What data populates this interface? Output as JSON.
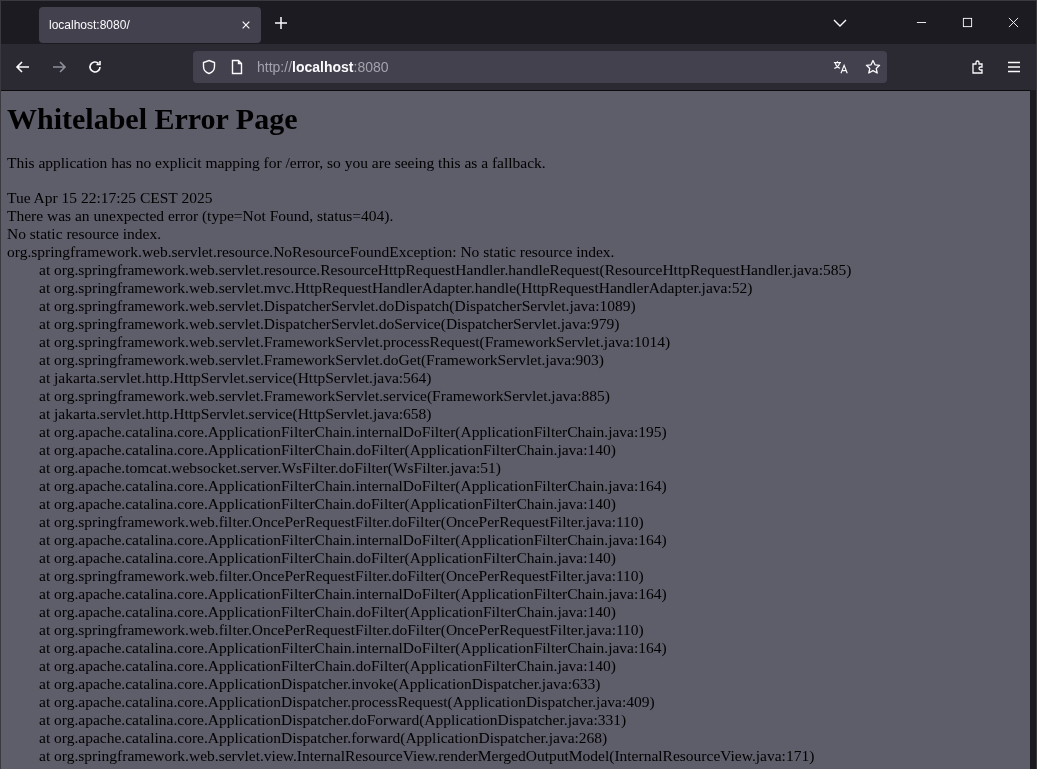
{
  "tabs": [
    {
      "title": "localhost:8080/",
      "selected": true
    }
  ],
  "url": {
    "scheme": "http://",
    "host": "localhost",
    "port": ":8080"
  },
  "nav": {
    "forward_disabled": true
  },
  "page": {
    "heading": "Whitelabel Error Page",
    "intro": "This application has no explicit mapping for /error, so you are seeing this as a fallback.",
    "lines": [
      "Tue Apr 15 22:17:25 CEST 2025",
      "There was an unexpected error (type=Not Found, status=404).",
      "No static resource index.",
      "org.springframework.web.servlet.resource.NoResourceFoundException: No static resource index."
    ],
    "trace": [
      "at org.springframework.web.servlet.resource.ResourceHttpRequestHandler.handleRequest(ResourceHttpRequestHandler.java:585)",
      "at org.springframework.web.servlet.mvc.HttpRequestHandlerAdapter.handle(HttpRequestHandlerAdapter.java:52)",
      "at org.springframework.web.servlet.DispatcherServlet.doDispatch(DispatcherServlet.java:1089)",
      "at org.springframework.web.servlet.DispatcherServlet.doService(DispatcherServlet.java:979)",
      "at org.springframework.web.servlet.FrameworkServlet.processRequest(FrameworkServlet.java:1014)",
      "at org.springframework.web.servlet.FrameworkServlet.doGet(FrameworkServlet.java:903)",
      "at jakarta.servlet.http.HttpServlet.service(HttpServlet.java:564)",
      "at org.springframework.web.servlet.FrameworkServlet.service(FrameworkServlet.java:885)",
      "at jakarta.servlet.http.HttpServlet.service(HttpServlet.java:658)",
      "at org.apache.catalina.core.ApplicationFilterChain.internalDoFilter(ApplicationFilterChain.java:195)",
      "at org.apache.catalina.core.ApplicationFilterChain.doFilter(ApplicationFilterChain.java:140)",
      "at org.apache.tomcat.websocket.server.WsFilter.doFilter(WsFilter.java:51)",
      "at org.apache.catalina.core.ApplicationFilterChain.internalDoFilter(ApplicationFilterChain.java:164)",
      "at org.apache.catalina.core.ApplicationFilterChain.doFilter(ApplicationFilterChain.java:140)",
      "at org.springframework.web.filter.OncePerRequestFilter.doFilter(OncePerRequestFilter.java:110)",
      "at org.apache.catalina.core.ApplicationFilterChain.internalDoFilter(ApplicationFilterChain.java:164)",
      "at org.apache.catalina.core.ApplicationFilterChain.doFilter(ApplicationFilterChain.java:140)",
      "at org.springframework.web.filter.OncePerRequestFilter.doFilter(OncePerRequestFilter.java:110)",
      "at org.apache.catalina.core.ApplicationFilterChain.internalDoFilter(ApplicationFilterChain.java:164)",
      "at org.apache.catalina.core.ApplicationFilterChain.doFilter(ApplicationFilterChain.java:140)",
      "at org.springframework.web.filter.OncePerRequestFilter.doFilter(OncePerRequestFilter.java:110)",
      "at org.apache.catalina.core.ApplicationFilterChain.internalDoFilter(ApplicationFilterChain.java:164)",
      "at org.apache.catalina.core.ApplicationFilterChain.doFilter(ApplicationFilterChain.java:140)",
      "at org.apache.catalina.core.ApplicationDispatcher.invoke(ApplicationDispatcher.java:633)",
      "at org.apache.catalina.core.ApplicationDispatcher.processRequest(ApplicationDispatcher.java:409)",
      "at org.apache.catalina.core.ApplicationDispatcher.doForward(ApplicationDispatcher.java:331)",
      "at org.apache.catalina.core.ApplicationDispatcher.forward(ApplicationDispatcher.java:268)",
      "at org.springframework.web.servlet.view.InternalResourceView.renderMergedOutputModel(InternalResourceView.java:171)"
    ]
  }
}
